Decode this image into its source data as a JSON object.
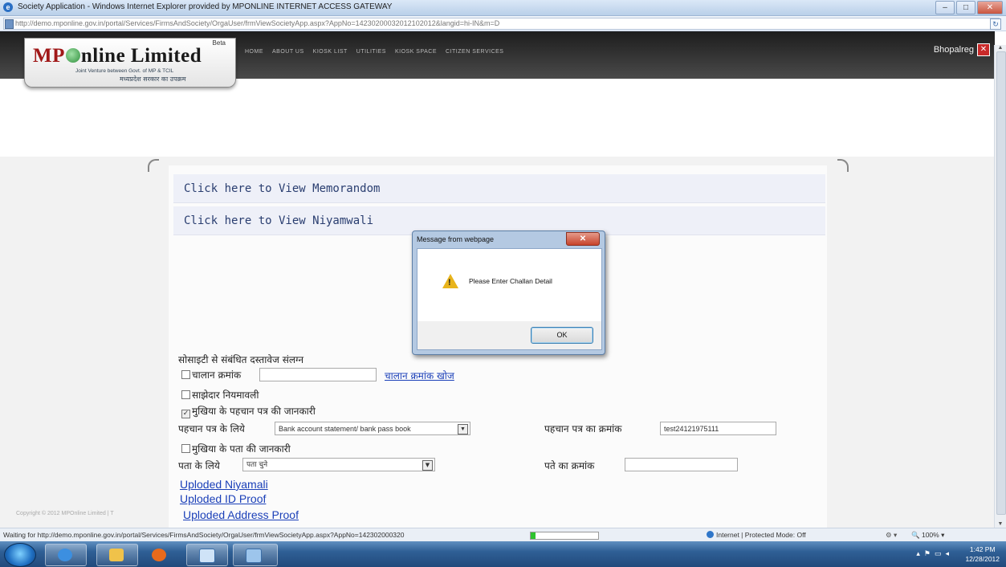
{
  "window": {
    "title": "Society Application - Windows Internet Explorer provided by MPONLINE INTERNET ACCESS GATEWAY",
    "url": "http://demo.mponline.gov.in/portal/Services/FirmsAndSociety/OrgaUser/frmViewSocietyApp.aspx?AppNo=14230200032012102012&langid=hi-IN&m=D",
    "minimize": "–",
    "maximize": "□",
    "close": "✕",
    "refresh": "↻"
  },
  "site": {
    "logo_text_red": "MP",
    "logo_text_black": "nline Limited",
    "beta": "Beta",
    "logo_sub": "Joint Venture between Govt. of MP & TCIL",
    "logo_sub_hindi": "मध्यप्रदेश सरकार का उपक्रम",
    "menu": [
      "HOME",
      "ABOUT US",
      "KIOSK LIST",
      "UTILITIES",
      "KIOSK SPACE",
      "CITIZEN SERVICES"
    ],
    "user": "Bhopalreg",
    "user_menu_icon": "✕"
  },
  "content": {
    "view_memorandom": "Click here to View Memorandom",
    "view_niyamwali": "Click here to View Niyamwali",
    "docs_heading": "सोसाइटी से संबंधित दस्तावेज संलग्न",
    "challan_label": "चालान क्रमांक",
    "challan_value": "",
    "challan_search_link": "चालान क्रमांक खोज",
    "shareholder_label": "साझेदार नियमावली",
    "head_id_label": "मुखिया के पहचान पत्र की जानकारी",
    "id_for_label": "पहचान पत्र के लिये",
    "id_type_selected": "Bank account statement/ bank pass book",
    "id_number_label": "पहचान पत्र का क्रमांक",
    "id_number_value": "test24121975111",
    "head_address_label": "मुखिया के पता की जानकारी",
    "address_for_label": "पता के लिये",
    "address_type_selected": "पता चुने",
    "address_number_label": "पते का क्रमांक",
    "address_number_value": "",
    "uploaded_niyamali": "Uploded Niyamali",
    "uploaded_id_proof": "Uploded ID Proof",
    "uploaded_address_proof": "Uploded Address Proof",
    "copyright": "Copyright © 2012 MPOnline Limited | T"
  },
  "checkboxes": {
    "challan": false,
    "shareholder": false,
    "head_id": true,
    "head_address": false
  },
  "dialog": {
    "title": "Message from webpage",
    "close": "✕",
    "icon": "warning-icon",
    "message": "Please Enter Challan Detail",
    "ok": "OK"
  },
  "statusbar": {
    "status": "Waiting for http://demo.mponline.gov.in/portal/Services/FirmsAndSociety/OrgaUser/frmViewSocietyApp.aspx?AppNo=142302000320",
    "progress": 0.07,
    "zone": "Internet | Protected Mode: Off",
    "zoom": "100%",
    "zoom_prefix": "🔍"
  },
  "taskbar": {
    "time": "1:42 PM",
    "date": "12/28/2012",
    "items": [
      "internet-explorer",
      "file-explorer",
      "media-player",
      "remote-desktop",
      "paint"
    ]
  }
}
